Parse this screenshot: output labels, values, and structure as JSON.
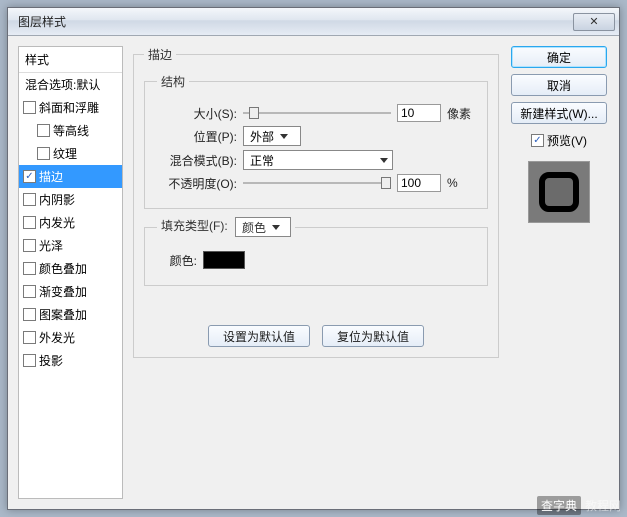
{
  "window": {
    "title": "图层样式"
  },
  "styles": {
    "header": "样式",
    "blend_default": "混合选项:默认",
    "items": [
      {
        "label": "斜面和浮雕",
        "checked": false
      },
      {
        "label": "等高线",
        "checked": false,
        "indent": true
      },
      {
        "label": "纹理",
        "checked": false,
        "indent": true
      },
      {
        "label": "描边",
        "checked": true,
        "selected": true
      },
      {
        "label": "内阴影",
        "checked": false
      },
      {
        "label": "内发光",
        "checked": false
      },
      {
        "label": "光泽",
        "checked": false
      },
      {
        "label": "颜色叠加",
        "checked": false
      },
      {
        "label": "渐变叠加",
        "checked": false
      },
      {
        "label": "图案叠加",
        "checked": false
      },
      {
        "label": "外发光",
        "checked": false
      },
      {
        "label": "投影",
        "checked": false
      }
    ]
  },
  "stroke": {
    "legend": "描边",
    "structure_legend": "结构",
    "size_label": "大小(S):",
    "size_value": "10",
    "size_unit": "像素",
    "position_label": "位置(P):",
    "position_value": "外部",
    "blend_label": "混合模式(B):",
    "blend_value": "正常",
    "opacity_label": "不透明度(O):",
    "opacity_value": "100",
    "opacity_unit": "%",
    "fill_legend": "填充类型(F):",
    "fill_value": "颜色",
    "color_label": "颜色:",
    "color_value": "#000000",
    "make_default": "设置为默认值",
    "reset_default": "复位为默认值"
  },
  "actions": {
    "ok": "确定",
    "cancel": "取消",
    "new_style": "新建样式(W)...",
    "preview": "预览(V)"
  },
  "watermark": {
    "logo": "查字典",
    "text": "教程网"
  }
}
